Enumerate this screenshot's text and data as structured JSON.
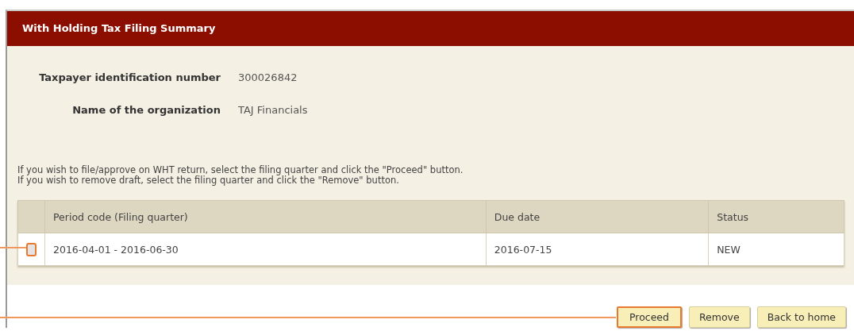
{
  "panel": {
    "title": "With Holding Tax Filing Summary"
  },
  "fields": [
    {
      "label": "Taxpayer identification number",
      "value": "300026842"
    },
    {
      "label": "Name of the organization",
      "value": "TAJ Financials"
    }
  ],
  "instructions": [
    "If you wish to file/approve on WHT return, select the filing quarter and click the \"Proceed\" button.",
    "If you wish to remove draft, select the filing quarter and click the \"Remove\" button."
  ],
  "table": {
    "columns": [
      "Period code (Filing quarter)",
      "Due date",
      "Status"
    ],
    "rows": [
      {
        "checked": false,
        "highlighted": true,
        "cells": [
          "2016-04-01 - 2016-06-30",
          "2016-07-15",
          "NEW"
        ]
      }
    ]
  },
  "buttons": [
    {
      "label": "Proceed",
      "highlighted": true
    },
    {
      "label": "Remove",
      "highlighted": false
    },
    {
      "label": "Back to home",
      "highlighted": false
    }
  ]
}
